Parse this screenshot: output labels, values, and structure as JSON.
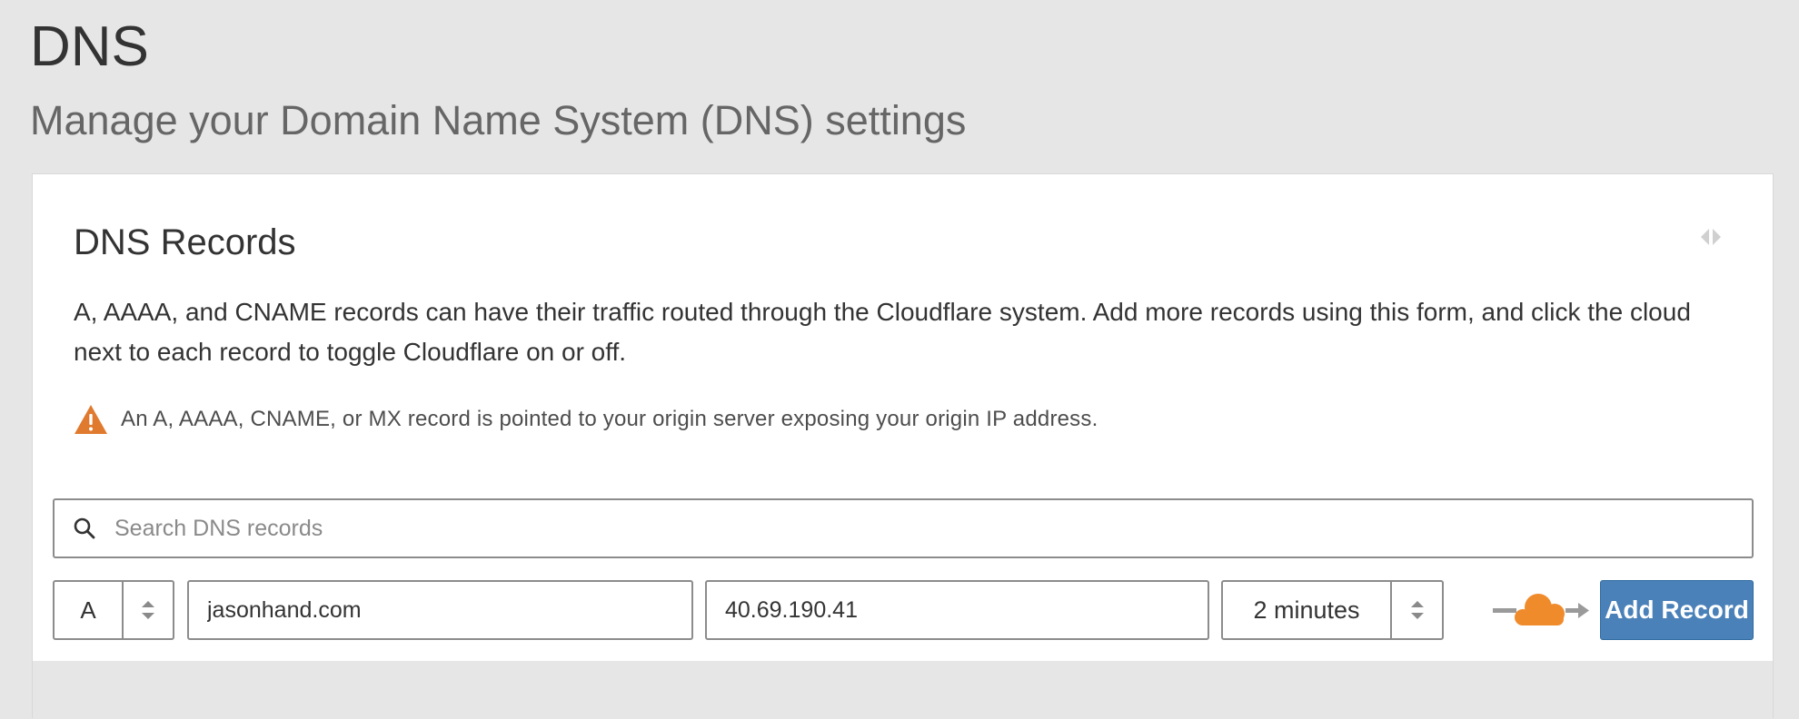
{
  "page": {
    "title": "DNS",
    "subtitle": "Manage your Domain Name System (DNS) settings"
  },
  "card": {
    "title": "DNS Records",
    "description": "A, AAAA, and CNAME records can have their traffic routed through the Cloudflare system. Add more records using this form, and click the cloud next to each record to toggle Cloudflare on or off.",
    "warning": "An A, AAAA, CNAME, or MX record is pointed to your origin server exposing your origin IP address."
  },
  "search": {
    "placeholder": "Search DNS records",
    "value": ""
  },
  "form": {
    "type": "A",
    "name": "jasonhand.com",
    "content": "40.69.190.41",
    "ttl": "2 minutes",
    "add_label": "Add Record"
  },
  "colors": {
    "background": "#e6e6e6",
    "warning": "#e07a2f",
    "cloud": "#f08b2c",
    "button": "#4a81b8"
  },
  "icons": {
    "warning": "warning-triangle-icon",
    "search": "search-icon",
    "collapse": "collapse-arrows-icon",
    "stepper": "up-down-chevron-icon",
    "proxy": "orange-cloud-icon"
  }
}
